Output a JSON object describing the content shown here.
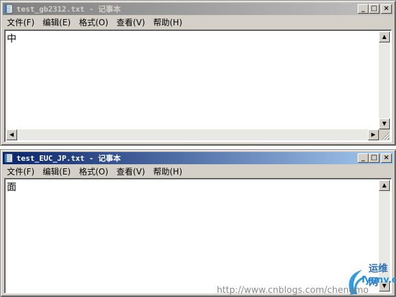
{
  "window1": {
    "title": "test_gb2312.txt - 记事本",
    "content": "中"
  },
  "window2": {
    "title": "test_EUC_JP.txt - 记事本",
    "content": "面"
  },
  "menu": {
    "file": "文件(F)",
    "edit": "编辑(E)",
    "format": "格式(O)",
    "view": "查看(V)",
    "help": "帮助(H)"
  },
  "controls": {
    "minimize": "_",
    "maximize": "□",
    "close": "×"
  },
  "watermark": {
    "url": "http://www.cnblogs.com/chengmo",
    "brand": "运维网",
    "brand_url": "iyunv.com"
  }
}
